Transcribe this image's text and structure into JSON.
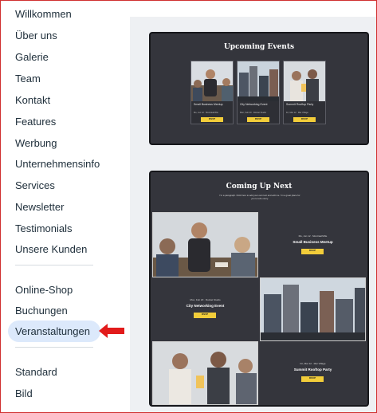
{
  "sidebar": {
    "items": [
      {
        "label": "Willkommen"
      },
      {
        "label": "Über uns"
      },
      {
        "label": "Galerie"
      },
      {
        "label": "Team"
      },
      {
        "label": "Kontakt"
      },
      {
        "label": "Features"
      },
      {
        "label": "Werbung"
      },
      {
        "label": "Unternehmensinfo"
      },
      {
        "label": "Services"
      },
      {
        "label": "Newsletter"
      },
      {
        "label": "Testimonials"
      },
      {
        "label": "Unsere Kunden"
      }
    ],
    "group2": [
      {
        "label": "Online-Shop"
      },
      {
        "label": "Buchungen"
      },
      {
        "label": "Veranstaltungen"
      }
    ],
    "group3": [
      {
        "label": "Standard"
      },
      {
        "label": "Bild"
      }
    ],
    "active": "Veranstaltungen"
  },
  "preview1": {
    "title": "Upcoming Events",
    "cards": [
      {
        "title": "Small Business Meetup",
        "meta": "Mo, Jun 12  ·  Montréal/Ville"
      },
      {
        "title": "City Networking Event",
        "meta": "Mon, Feb 20  ·  Rocket Studio"
      },
      {
        "title": "Summit Rooftop Party",
        "meta": "Fri, Mar 12  ·  Mar Village"
      }
    ],
    "button": "RSVP"
  },
  "preview2": {
    "title": "Coming Up Next",
    "subtitle": "I'm a paragraph. Click here to add your own text and edit me. I'm a great place for you to tell a story.",
    "events": [
      {
        "meta": "Mo, Jun 12  ·  Montréal/Ville",
        "title": "Small Business Meetup"
      },
      {
        "meta": "Mon, Feb 20  ·  Rocket Studio",
        "title": "City Networking Event"
      },
      {
        "meta": "Fri, Mar 12  ·  Mar Village",
        "title": "Summit Rooftop Party"
      }
    ],
    "button": "RSVP"
  },
  "colors": {
    "accent": "#f2cd3a",
    "panel": "#34353c",
    "active_bg": "#dce9fb",
    "arrow": "#e21b1b"
  }
}
